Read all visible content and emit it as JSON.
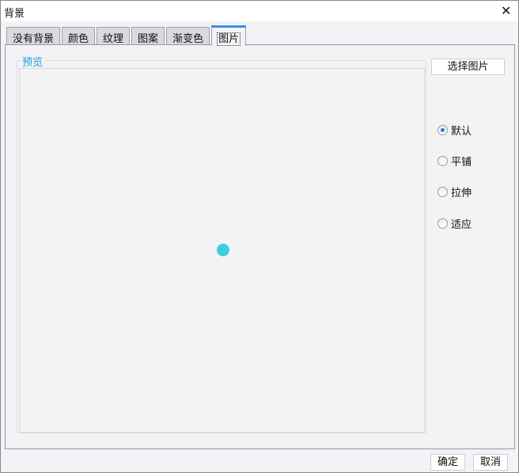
{
  "window": {
    "title": "背景",
    "close_icon": "close-icon"
  },
  "tabs": [
    {
      "label": "没有背景"
    },
    {
      "label": "颜色"
    },
    {
      "label": "纹理"
    },
    {
      "label": "图案"
    },
    {
      "label": "渐变色"
    },
    {
      "label": "图片",
      "active": true
    }
  ],
  "preview": {
    "legend": "预览",
    "dot_color": "#3ccfdf"
  },
  "select_image_label": "选择图片",
  "modes": [
    {
      "label": "默认",
      "checked": true
    },
    {
      "label": "平铺"
    },
    {
      "label": "拉伸"
    },
    {
      "label": "适应"
    }
  ],
  "footer": {
    "ok": "确定",
    "cancel": "取消"
  }
}
